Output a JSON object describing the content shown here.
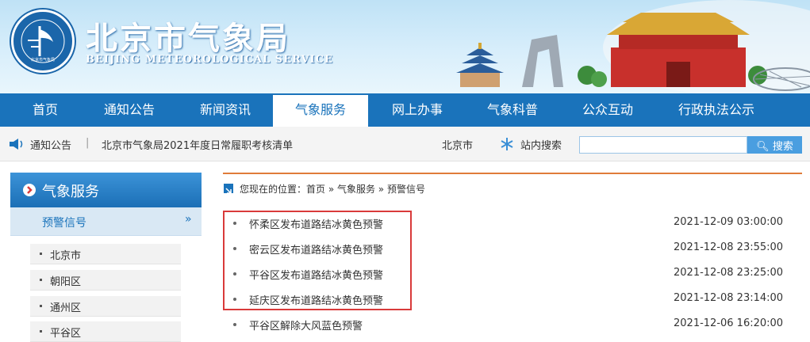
{
  "header": {
    "brand_cn": "北京市气象局",
    "brand_en": "BEIJING METEOROLOGICAL SERVICE",
    "logo_ring_text": "BEIJING METEOROLOGICAL SERVICE",
    "logo_center_text": "北京市气象局"
  },
  "nav": {
    "items": [
      "首页",
      "通知公告",
      "新闻资讯",
      "气象服务",
      "网上办事",
      "气象科普",
      "公众互动",
      "行政执法公示"
    ],
    "active_index": 3
  },
  "notice": {
    "label": "通知公告",
    "separator": "|",
    "text": "北京市气象局2021年度日常履职考核清单",
    "city": "北京市",
    "search_label": "站内搜索",
    "search_value": "",
    "search_button": "搜索"
  },
  "sidebar": {
    "title": "气象服务",
    "current": "预警信号",
    "arrow": "»",
    "items": [
      "北京市",
      "朝阳区",
      "通州区",
      "平谷区"
    ]
  },
  "breadcrumb": {
    "text": "您现在的位置：首页 » 气象服务 » 预警信号"
  },
  "news": [
    {
      "title": "怀柔区发布道路结冰黄色预警",
      "date": "2021-12-09 03:00:00"
    },
    {
      "title": "密云区发布道路结冰黄色预警",
      "date": "2021-12-08 23:55:00"
    },
    {
      "title": "平谷区发布道路结冰黄色预警",
      "date": "2021-12-08 23:25:00"
    },
    {
      "title": "延庆区发布道路结冰黄色预警",
      "date": "2021-12-08 23:14:00"
    },
    {
      "title": "平谷区解除大风蓝色预警",
      "date": "2021-12-06 16:20:00"
    }
  ],
  "colors": {
    "nav_bg": "#1a73bb",
    "highlight": "#d93a3a",
    "accent_line": "#e07b39"
  }
}
